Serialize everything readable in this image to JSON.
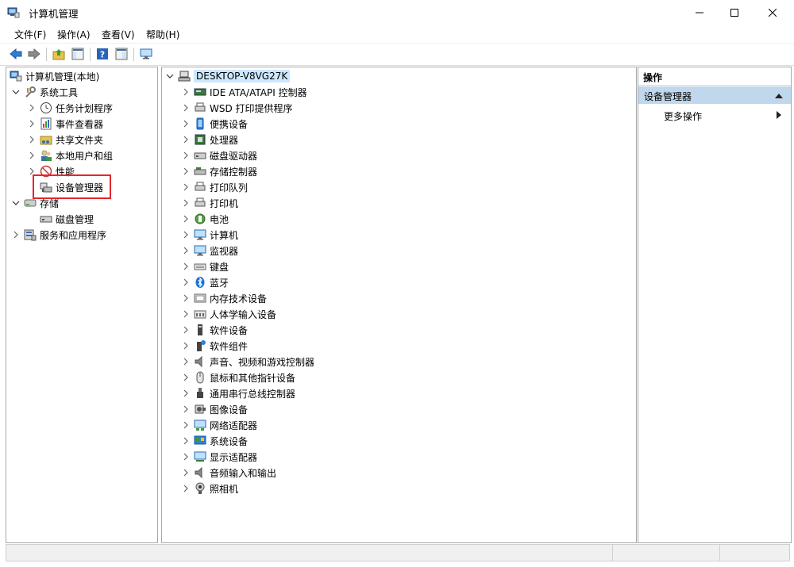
{
  "window": {
    "title": "计算机管理"
  },
  "menubar": [
    "文件(F)",
    "操作(A)",
    "查看(V)",
    "帮助(H)"
  ],
  "toolbar_icons": [
    "back-arrow-icon",
    "forward-arrow-icon",
    "up-folder-icon",
    "show-hide-tree-icon",
    "help-icon",
    "properties-icon",
    "monitor-icon"
  ],
  "left_tree": {
    "root": "计算机管理(本地)",
    "system_tools": {
      "label": "系统工具",
      "items": [
        "任务计划程序",
        "事件查看器",
        "共享文件夹",
        "本地用户和组",
        "性能",
        "设备管理器"
      ]
    },
    "storage": {
      "label": "存储",
      "items": [
        "磁盘管理"
      ]
    },
    "services": "服务和应用程序"
  },
  "device_tree": {
    "root": "DESKTOP-V8VG27K",
    "categories": [
      "IDE ATA/ATAPI 控制器",
      "WSD 打印提供程序",
      "便携设备",
      "处理器",
      "磁盘驱动器",
      "存储控制器",
      "打印队列",
      "打印机",
      "电池",
      "计算机",
      "监视器",
      "键盘",
      "蓝牙",
      "内存技术设备",
      "人体学输入设备",
      "软件设备",
      "软件组件",
      "声音、视频和游戏控制器",
      "鼠标和其他指针设备",
      "通用串行总线控制器",
      "图像设备",
      "网络适配器",
      "系统设备",
      "显示适配器",
      "音频输入和输出",
      "照相机"
    ]
  },
  "actions": {
    "header": "操作",
    "section": "设备管理器",
    "more": "更多操作"
  },
  "colors": {
    "highlight": "#e5262d",
    "section_bg": "#c0d7ec",
    "selected_bg": "#cce8ff"
  }
}
